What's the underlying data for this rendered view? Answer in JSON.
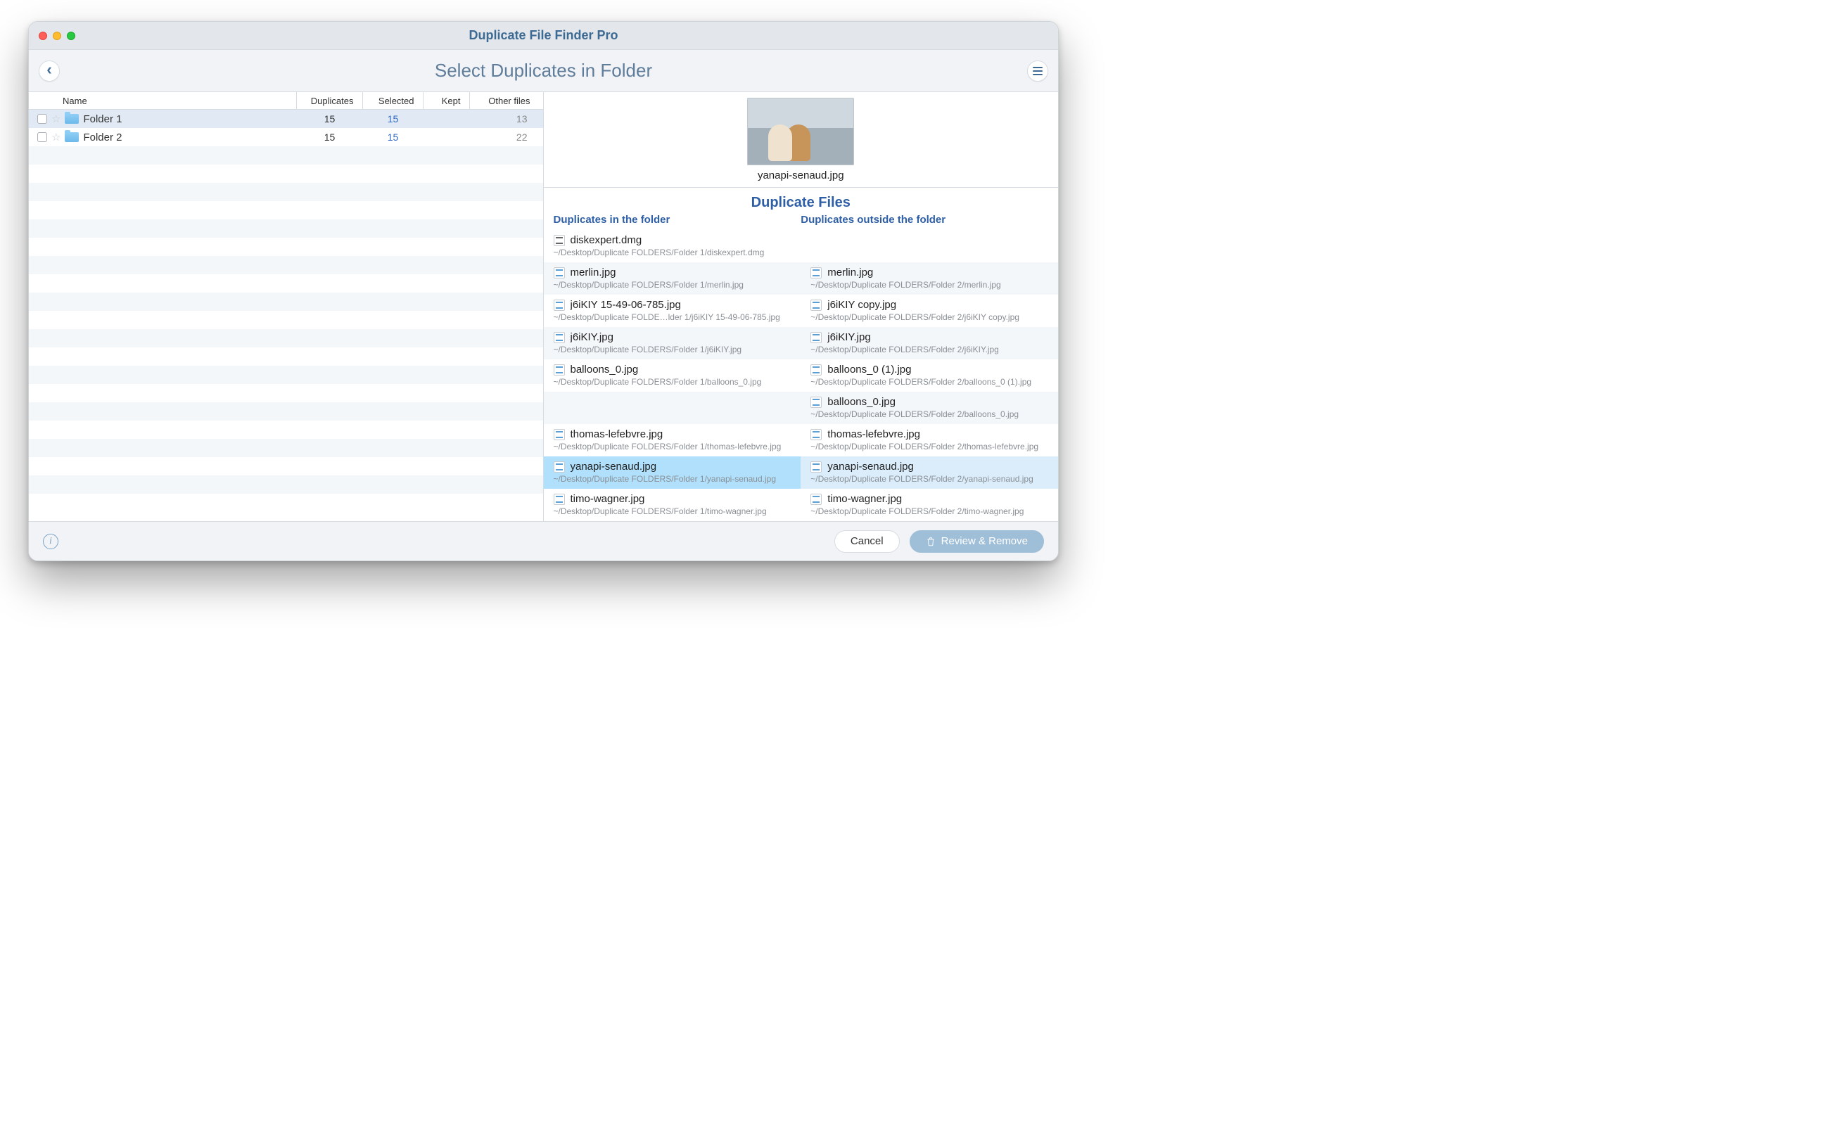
{
  "window": {
    "title": "Duplicate File Finder Pro",
    "subtitle": "Select Duplicates in Folder"
  },
  "table": {
    "headers": {
      "name": "Name",
      "duplicates": "Duplicates",
      "selected": "Selected",
      "kept": "Kept",
      "other": "Other files"
    },
    "rows": [
      {
        "name": "Folder 1",
        "duplicates": "15",
        "selected": "15",
        "kept": "",
        "other": "13",
        "selected_row": true
      },
      {
        "name": "Folder 2",
        "duplicates": "15",
        "selected": "15",
        "kept": "",
        "other": "22",
        "selected_row": false
      }
    ]
  },
  "preview": {
    "filename": "yanapi-senaud.jpg"
  },
  "detail": {
    "title": "Duplicate Files",
    "left_title": "Duplicates in the folder",
    "right_title": "Duplicates outside the folder",
    "pairs": [
      {
        "hl": false,
        "left": {
          "icon": "dmg",
          "name": "diskexpert.dmg",
          "path": "~/Desktop/Duplicate FOLDERS/Folder 1/diskexpert.dmg"
        },
        "right": null
      },
      {
        "hl": false,
        "left": {
          "icon": "img",
          "name": "merlin.jpg",
          "path": "~/Desktop/Duplicate FOLDERS/Folder 1/merlin.jpg"
        },
        "right": {
          "icon": "img",
          "name": "merlin.jpg",
          "path": "~/Desktop/Duplicate FOLDERS/Folder 2/merlin.jpg"
        }
      },
      {
        "hl": false,
        "left": {
          "icon": "img",
          "name": "j6iKIY 15-49-06-785.jpg",
          "path": "~/Desktop/Duplicate FOLDE…lder 1/j6iKIY 15-49-06-785.jpg"
        },
        "right": {
          "icon": "img",
          "name": "j6iKIY copy.jpg",
          "path": "~/Desktop/Duplicate FOLDERS/Folder 2/j6iKIY copy.jpg"
        }
      },
      {
        "hl": false,
        "left": {
          "icon": "img",
          "name": "j6iKIY.jpg",
          "path": "~/Desktop/Duplicate FOLDERS/Folder 1/j6iKIY.jpg"
        },
        "right": {
          "icon": "img",
          "name": "j6iKIY.jpg",
          "path": "~/Desktop/Duplicate FOLDERS/Folder 2/j6iKIY.jpg"
        }
      },
      {
        "hl": false,
        "left": {
          "icon": "img",
          "name": "balloons_0.jpg",
          "path": "~/Desktop/Duplicate FOLDERS/Folder 1/balloons_0.jpg"
        },
        "right": {
          "icon": "img",
          "name": "balloons_0 (1).jpg",
          "path": "~/Desktop/Duplicate FOLDERS/Folder 2/balloons_0 (1).jpg"
        }
      },
      {
        "hl": false,
        "left": null,
        "right": {
          "icon": "img",
          "name": "balloons_0.jpg",
          "path": "~/Desktop/Duplicate FOLDERS/Folder 2/balloons_0.jpg"
        }
      },
      {
        "hl": false,
        "left": {
          "icon": "img",
          "name": "thomas-lefebvre.jpg",
          "path": "~/Desktop/Duplicate FOLDERS/Folder 1/thomas-lefebvre.jpg"
        },
        "right": {
          "icon": "img",
          "name": "thomas-lefebvre.jpg",
          "path": "~/Desktop/Duplicate FOLDERS/Folder 2/thomas-lefebvre.jpg"
        }
      },
      {
        "hl": true,
        "left": {
          "icon": "img",
          "name": "yanapi-senaud.jpg",
          "path": "~/Desktop/Duplicate FOLDERS/Folder 1/yanapi-senaud.jpg"
        },
        "right": {
          "icon": "img",
          "name": "yanapi-senaud.jpg",
          "path": "~/Desktop/Duplicate FOLDERS/Folder 2/yanapi-senaud.jpg"
        }
      },
      {
        "hl": false,
        "left": {
          "icon": "img",
          "name": "timo-wagner.jpg",
          "path": "~/Desktop/Duplicate FOLDERS/Folder 1/timo-wagner.jpg"
        },
        "right": {
          "icon": "img",
          "name": "timo-wagner.jpg",
          "path": "~/Desktop/Duplicate FOLDERS/Folder 2/timo-wagner.jpg"
        }
      }
    ]
  },
  "footer": {
    "cancel": "Cancel",
    "review": "Review & Remove"
  }
}
